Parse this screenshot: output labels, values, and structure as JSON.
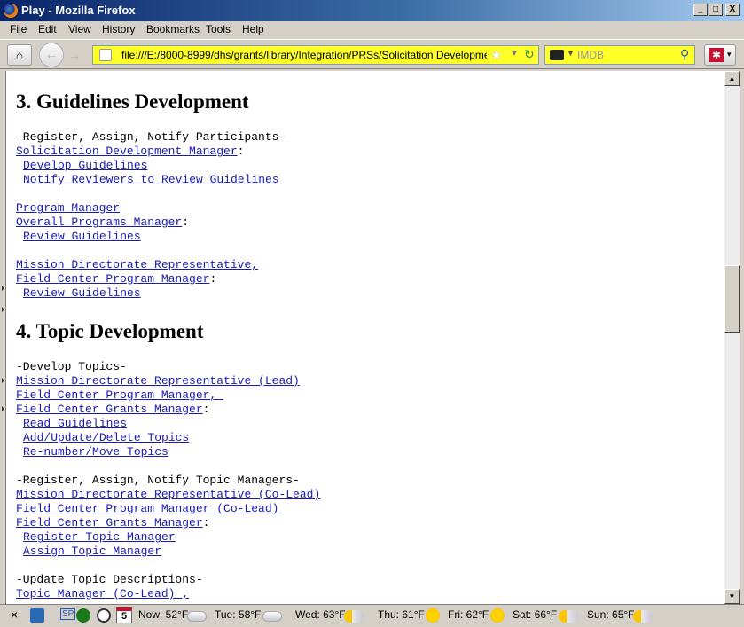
{
  "window": {
    "title": "Play - Mozilla Firefox",
    "minimize_label": "_",
    "maximize_label": "□",
    "close_label": "X"
  },
  "menu": [
    "File",
    "Edit",
    "View",
    "History",
    "Bookmarks",
    "Tools",
    "Help"
  ],
  "navbar": {
    "url": "file:///E:/8000-8999/dhs/grants/library/Integration/PRSs/Solicitation Development/Pla",
    "search_placeholder": "IMDB",
    "icons": [
      "home-icon",
      "back-icon",
      "forward-icon",
      "star-icon",
      "reload-icon",
      "search-icon"
    ]
  },
  "content": {
    "section3": {
      "heading": "3. Guidelines Development",
      "phase1": "-Register, Assign, Notify Participants-",
      "role1": "Solicitation Development Manager",
      "role1_colon": ":",
      "action1a": "Develop Guidelines",
      "action1b": "Notify Reviewers to Review Guidelines",
      "role2a": "Program Manager",
      "role2b": "Overall Programs Manager",
      "role2_colon": ":",
      "action2": "Review Guidelines",
      "role3a": "Mission Directorate Representative,",
      "role3b": "Field Center Program Manager",
      "role3_colon": ":",
      "action3": "Review Guidelines"
    },
    "section4": {
      "heading": "4. Topic Development",
      "phase1": "-Develop Topics-",
      "role1a": "Mission Directorate Representative (Lead)",
      "role1b": "Field Center Program Manager, ",
      "role1c": "Field Center Grants Manager",
      "role1_colon": ":",
      "action1a": "Read Guidelines",
      "action1b": "Add/Update/Delete Topics",
      "action1c": "Re-number/Move Topics",
      "phase2": "-Register, Assign, Notify Topic Managers-",
      "role2a": "Mission Directorate Representative (Co-Lead)",
      "role2b": "Field Center Program Manager (Co-Lead)",
      "role2c": "Field Center Grants Manager",
      "role2_colon": ":",
      "action2a": "Register Topic Manager",
      "action2b": "Assign Topic Manager",
      "phase3": "-Update Topic Descriptions-",
      "role3a": "Topic Manager (Co-Lead) ,"
    }
  },
  "statusbar": {
    "close_label": "×",
    "sp_label": "SP",
    "calendar_day": "5",
    "weather": [
      {
        "label": "Now: 52°F",
        "icon": "cloud-icon"
      },
      {
        "label": "Tue: 58°F",
        "icon": "cloud-icon"
      },
      {
        "label": "Wed: 63°F",
        "icon": "partly-sunny-icon"
      },
      {
        "label": "Thu: 61°F",
        "icon": "sun-icon"
      },
      {
        "label": "Fri: 62°F",
        "icon": "sun-icon"
      },
      {
        "label": "Sat: 66°F",
        "icon": "partly-sunny-icon"
      },
      {
        "label": "Sun: 65°F",
        "icon": "partly-sunny-icon"
      }
    ]
  }
}
